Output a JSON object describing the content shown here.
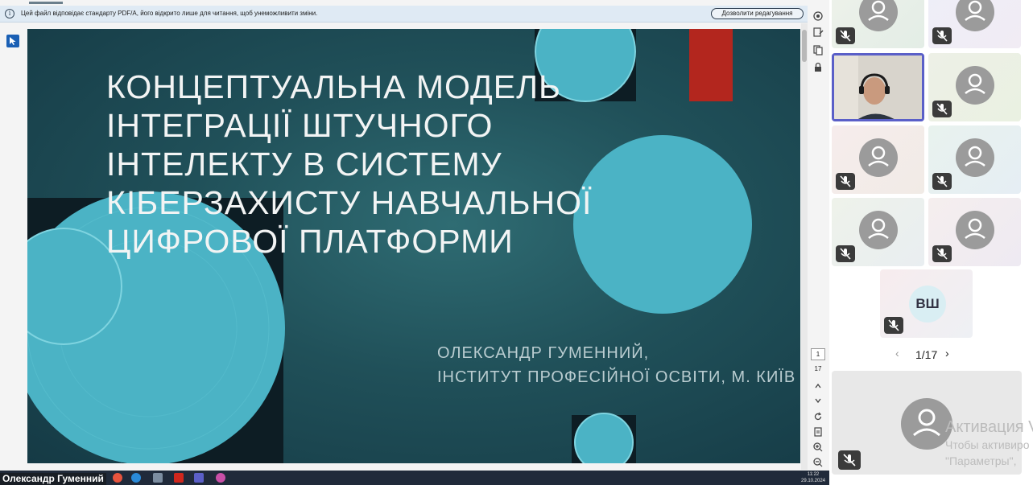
{
  "pdf_banner": {
    "info_icon": "info-icon",
    "message": "Цей файл відповідає стандарту PDF/A, його відкрито лише для читання, щоб унеможливити зміни.",
    "button_label": "Дозволити редагування"
  },
  "slide": {
    "title": "Концептуальна модель інтеграції штучного інтелекту в систему кіберзахисту навчальної цифрової платформи",
    "author_line1": "Олександр Гуменний,",
    "author_line2": "Інститут професійної освіти, м. Київ",
    "colors": {
      "teal": "#4bb3c5",
      "dark": "#0d1d24",
      "red": "#b3261e"
    }
  },
  "viewer": {
    "current_page": "1",
    "total_pages": "17"
  },
  "taskbar": {
    "time": "11:22",
    "date": "29.10.2024"
  },
  "presenter_name": "Олександр Гуменний",
  "participants": {
    "pager": "1/17",
    "initials_tile": "ВШ"
  },
  "watermark": {
    "line1": "Активация V",
    "line2": "Чтобы активиро",
    "line3": "\"Параметры\","
  }
}
